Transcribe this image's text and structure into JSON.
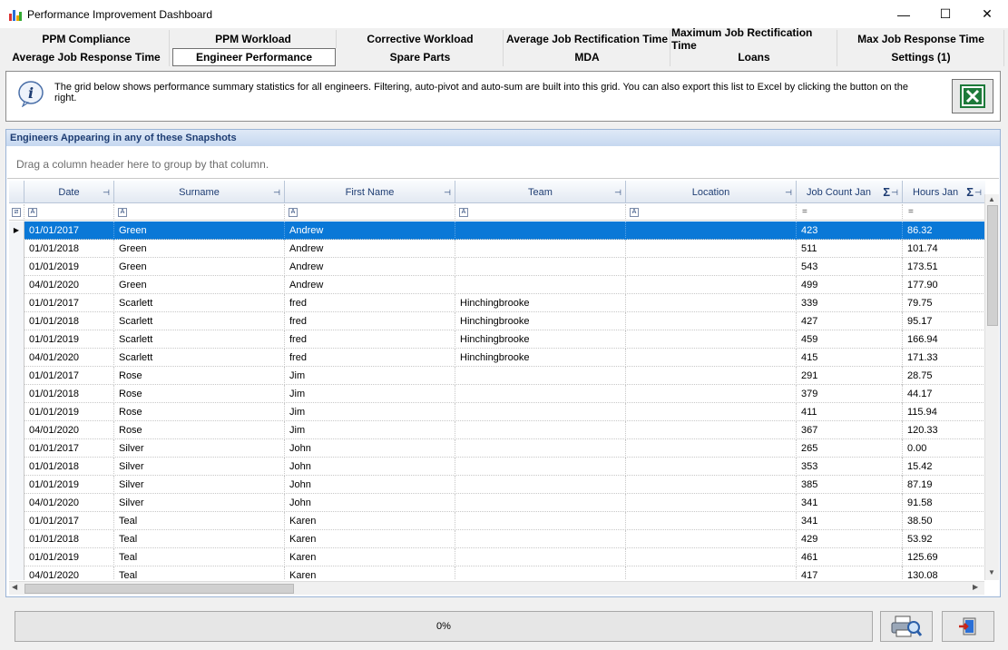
{
  "window": {
    "title": "Performance Improvement Dashboard",
    "minimize": "—",
    "maximize": "☐",
    "close": "✕"
  },
  "tabs": {
    "row1": [
      "PPM Compliance",
      "PPM Workload",
      "Corrective Workload",
      "Average Job Rectification Time",
      "Maximum Job Rectification Time",
      "Max Job Response Time"
    ],
    "row2": [
      "Average Job Response Time",
      "Engineer Performance",
      "Spare Parts",
      "MDA",
      "Loans",
      "Settings (1)"
    ],
    "selected": "Engineer Performance"
  },
  "info": {
    "text": "The grid below shows performance summary statistics for all engineers. Filtering, auto-pivot and auto-sum are built into this grid. You can also export this list to Excel by clicking the button on the right."
  },
  "grid": {
    "caption": "Engineers Appearing in any of these Snapshots",
    "group_hint": "Drag a column header here to group by that column.",
    "columns": [
      "Date",
      "Surname",
      "First Name",
      "Team",
      "Location",
      "Job Count Jan",
      "Hours Jan"
    ],
    "rows": [
      [
        "01/01/2017",
        "Green",
        "Andrew",
        "",
        "",
        "423",
        "86.32"
      ],
      [
        "01/01/2018",
        "Green",
        "Andrew",
        "",
        "",
        "511",
        "101.74"
      ],
      [
        "01/01/2019",
        "Green",
        "Andrew",
        "",
        "",
        "543",
        "173.51"
      ],
      [
        "04/01/2020",
        "Green",
        "Andrew",
        "",
        "",
        "499",
        "177.90"
      ],
      [
        "01/01/2017",
        "Scarlett",
        "fred",
        "Hinchingbrooke",
        "",
        "339",
        "79.75"
      ],
      [
        "01/01/2018",
        "Scarlett",
        "fred",
        "Hinchingbrooke",
        "",
        "427",
        "95.17"
      ],
      [
        "01/01/2019",
        "Scarlett",
        "fred",
        "Hinchingbrooke",
        "",
        "459",
        "166.94"
      ],
      [
        "04/01/2020",
        "Scarlett",
        "fred",
        "Hinchingbrooke",
        "",
        "415",
        "171.33"
      ],
      [
        "01/01/2017",
        "Rose",
        "Jim",
        "",
        "",
        "291",
        "28.75"
      ],
      [
        "01/01/2018",
        "Rose",
        "Jim",
        "",
        "",
        "379",
        "44.17"
      ],
      [
        "01/01/2019",
        "Rose",
        "Jim",
        "",
        "",
        "411",
        "115.94"
      ],
      [
        "04/01/2020",
        "Rose",
        "Jim",
        "",
        "",
        "367",
        "120.33"
      ],
      [
        "01/01/2017",
        "Silver",
        "John",
        "",
        "",
        "265",
        "0.00"
      ],
      [
        "01/01/2018",
        "Silver",
        "John",
        "",
        "",
        "353",
        "15.42"
      ],
      [
        "01/01/2019",
        "Silver",
        "John",
        "",
        "",
        "385",
        "87.19"
      ],
      [
        "04/01/2020",
        "Silver",
        "John",
        "",
        "",
        "341",
        "91.58"
      ],
      [
        "01/01/2017",
        "Teal",
        "Karen",
        "",
        "",
        "341",
        "38.50"
      ],
      [
        "01/01/2018",
        "Teal",
        "Karen",
        "",
        "",
        "429",
        "53.92"
      ],
      [
        "01/01/2019",
        "Teal",
        "Karen",
        "",
        "",
        "461",
        "125.69"
      ],
      [
        "04/01/2020",
        "Teal",
        "Karen",
        "",
        "",
        "417",
        "130.08"
      ]
    ]
  },
  "status": {
    "progress": "0%"
  },
  "icons": {
    "info": "info-icon",
    "excel": "excel-icon",
    "print": "print-preview-icon",
    "exit": "exit-icon"
  },
  "colors": {
    "selection": "#0a78d7",
    "header_text": "#1e3d73",
    "excel_green": "#1d7a3a"
  }
}
